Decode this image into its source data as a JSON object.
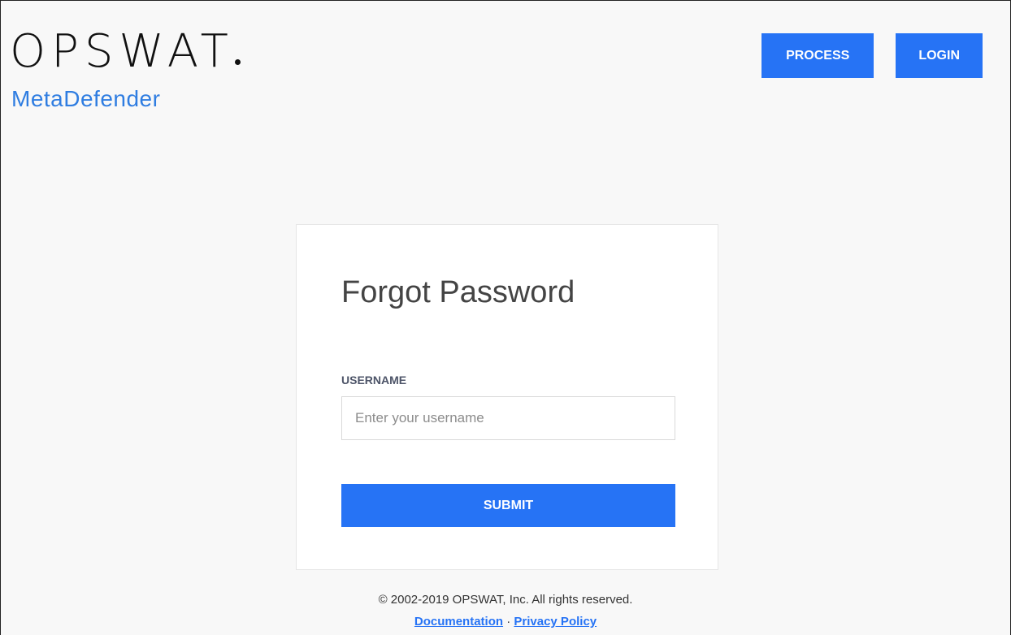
{
  "brand": {
    "logo_text": "OPSWAT",
    "product_name": "MetaDefender"
  },
  "nav": {
    "process_label": "PROCESS",
    "login_label": "LOGIN"
  },
  "form": {
    "title": "Forgot Password",
    "username_label": "USERNAME",
    "username_value": "",
    "username_placeholder": "Enter your username",
    "submit_label": "SUBMIT"
  },
  "footer": {
    "copyright": "© 2002-2019 OPSWAT, Inc. All rights reserved.",
    "documentation_label": "Documentation",
    "separator": "·",
    "privacy_label": "Privacy Policy"
  },
  "colors": {
    "accent": "#2673f5",
    "product_blue": "#2f7de1",
    "background": "#f8f8f8"
  }
}
